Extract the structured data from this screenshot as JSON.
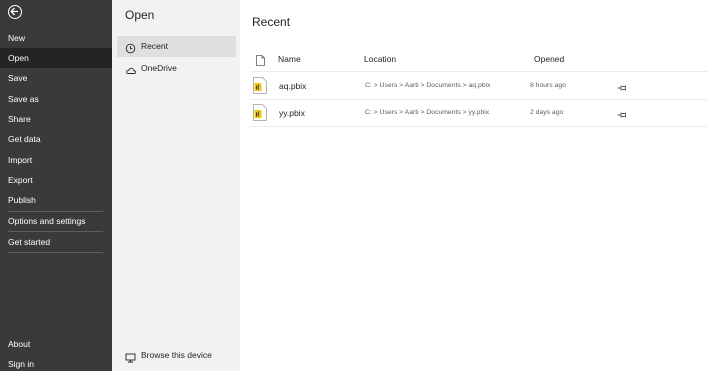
{
  "nav": {
    "items": [
      {
        "label": "New"
      },
      {
        "label": "Open"
      },
      {
        "label": "Save"
      },
      {
        "label": "Save as"
      },
      {
        "label": "Share"
      },
      {
        "label": "Get data"
      },
      {
        "label": "Import"
      },
      {
        "label": "Export"
      },
      {
        "label": "Publish"
      },
      {
        "label": "Options and settings"
      },
      {
        "label": "Get started"
      }
    ],
    "bottom": [
      {
        "label": "About"
      },
      {
        "label": "Sign in"
      }
    ],
    "selected": "Open"
  },
  "open_pane": {
    "title": "Open",
    "items": [
      {
        "label": "Recent",
        "icon": "clock-icon"
      },
      {
        "label": "OneDrive",
        "icon": "cloud-icon"
      }
    ],
    "browse_label": "Browse this device",
    "browse_icon": "monitor-icon"
  },
  "recent": {
    "title": "Recent",
    "columns": {
      "name": "Name",
      "location": "Location",
      "opened": "Opened"
    },
    "files": [
      {
        "name": "aq.pbix",
        "location": "C: > Users > Aarti > Documents > aq.pbix",
        "opened": "8 hours ago"
      },
      {
        "name": "yy.pbix",
        "location": "C: > Users > Aarti > Documents > yy.pbix",
        "opened": "2 days ago"
      }
    ]
  },
  "colors": {
    "nav_bg": "#3b3a39",
    "nav_active": "#252423",
    "pane_bg": "#f3f2f1",
    "pbix_yellow": "#f2c811"
  }
}
